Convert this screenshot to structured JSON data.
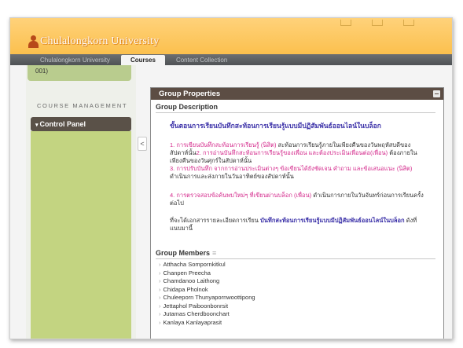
{
  "header": {
    "brand": "Chulalongkorn University"
  },
  "tabs": [
    {
      "label": "Chulalongkorn University"
    },
    {
      "label": "Courses"
    },
    {
      "label": "Content Collection"
    }
  ],
  "sidebar": {
    "course_id": "001)",
    "section_title": "COURSE MANAGEMENT",
    "control_panel": "Control Panel",
    "collapse_icon": "<"
  },
  "panel": {
    "title": "Group Properties",
    "description_label": "Group Description",
    "description_title": "ขั้นตอนการเรียนบันทึกสะท้อนการเรียนรู้แบบมีปฏิสัมพันธ์ออนไลน์ในบล็อก",
    "p1_pink": "1. การเขียนบันทึกสะท้อนการเรียนรู้ (นิสิต)",
    "p1_dark": " สะท้อนการเรียนรู้ภายในเพียงคืนของวันพฤหัสบดีของสัปดาห์นั้น",
    "p2_pink": "2. การอ่านบันทึกสะท้อนการเรียนรู้ของเพื่อน และต้องประเมินเพื่อนต่อ(เพื่อน)",
    "p2_dark": " ต้องภายในเพียงคืนของวันศุกร์ในสัปดาห์นั้น",
    "p3_pink": "3. การปรับบันทึก จากการอ่านประเมินต่างๆ ข้อเขียนได้ยังชัดเจน คำถาม และข้อเสนอแนะ",
    "p3_mid": " (นิสิต)",
    "p3_dark": " ดำเนินการและส่งภายในวันอาทิตย์ของสัปดาห์นั้น",
    "p4_pink": "4. การตรวจสอบข้อค้นพบใหม่ๆ ที่เขียนผ่านบล็อก",
    "p4_mid": " (เพื่อน)",
    "p4_dark": " ดำเนินการภายในวันจันทร์ก่อนการเรียนครั้งต่อไป",
    "p5_dark": "ที่จะได้เอกสารรายละเอียดการเรียน",
    "p5_blue": " บันทึกสะท้อนการเรียนรู้แบบมีปฏิสัมพันธ์ออนไลน์ในบล็อก",
    "p5_tail": " ดังที่แนบมานี้",
    "members_label": "Group Members",
    "members_icon": "≡",
    "members": [
      "Atthacha Sompornkitkul",
      "Chanpen Preecha",
      "Chamdanoo Laithong",
      "Chidapa Pholnok",
      "Chuleeporn Thunyapornwoottipong",
      "Jettaphol Paiboonbonrsit",
      "Jutamas Cherdboonchart",
      "Kanlaya Kanlayaprasit"
    ]
  },
  "colors": {
    "header": "#fbc04e",
    "tabbar": "#5a5d60",
    "panel_title": "#5c4d44",
    "sidebar_green": "#c3d481",
    "control_panel": "#5a5148",
    "pink_text": "#d42a8c",
    "blue_text": "#3b31a8"
  }
}
